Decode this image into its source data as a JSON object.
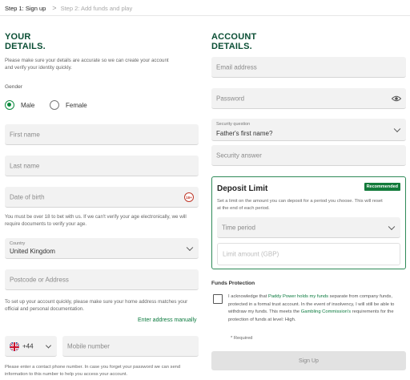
{
  "steps": {
    "step1": "Step 1: Sign up",
    "separator": ">",
    "step2": "Step 2: Add funds and play"
  },
  "your_details": {
    "heading_line1": "YOUR",
    "heading_line2": "DETAILS.",
    "intro_line1": "Please make sure your details are accurate so we can create your account",
    "intro_line2": "and verify your identity quickly.",
    "gender_label": "Gender",
    "male_label": "Male",
    "female_label": "Female",
    "selected_gender": "Male",
    "first_name_placeholder": "First name",
    "last_name_placeholder": "Last name",
    "dob_placeholder": "Date of birth",
    "age_badge": "18+",
    "age_note_line1": "You must be over 18 to bet with us. If we can't verify your age electronically, we will",
    "age_note_line2": "require documents to verify your age.",
    "country_label": "Country",
    "country_value": "United Kingdom",
    "postcode_placeholder": "Postcode or Address",
    "address_note_line1": "To set up your account quickly, please make sure your home address matches your",
    "address_note_line2": "official and personal documentation.",
    "manual_address_link": "Enter address manually",
    "phone_code": "+44",
    "mobile_placeholder": "Mobile number",
    "phone_note_line1": "Please enter a contact phone number. In case you forget your password we can send",
    "phone_note_line2": "information to this number to help you access your account."
  },
  "account_details": {
    "heading_line1": "ACCOUNT",
    "heading_line2": "DETAILS.",
    "email_placeholder": "Email address",
    "password_placeholder": "Password",
    "security_question_label": "Security question",
    "security_question_value": "Father's first name?",
    "security_answer_placeholder": "Security answer"
  },
  "deposit_limit": {
    "title": "Deposit Limit",
    "badge": "Recommended",
    "text_line1": "Set a limit on the amount you can deposit for a period you choose. This will reset",
    "text_line2": "at the end of each period.",
    "period_placeholder": "Time period",
    "amount_placeholder": "Limit amount (GBP)"
  },
  "funds_protection": {
    "label": "Funds Protection",
    "ack_part1": "I acknowledge that ",
    "ack_link1": "Paddy Power holds my funds",
    "ack_part2": " separate from company funds, protected in a formal trust account. In the event of insolvency, I will still be able to withdraw my funds. This meets the ",
    "ack_link2": "Gambling Commission's",
    "ack_part3": " requirements for the protection of funds at level: High.",
    "required_note": "* Required"
  },
  "signup_button": "Sign Up",
  "colors": {
    "brand_green": "#0b4f35",
    "accent_green": "#0b8a3e",
    "field_bg": "#f2f2f2"
  }
}
